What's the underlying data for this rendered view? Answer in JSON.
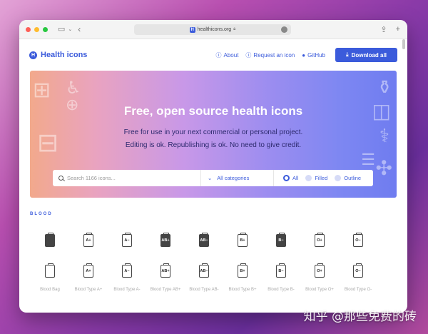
{
  "browser": {
    "url": "healthicons.org",
    "favicon_letter": "H"
  },
  "nav": {
    "logo_letter": "H",
    "brand": "Health icons",
    "links": [
      {
        "label": "About",
        "icon": "info-icon"
      },
      {
        "label": "Request an icon",
        "icon": "help-icon"
      },
      {
        "label": "GitHub",
        "icon": "github-icon"
      }
    ],
    "download_label": "Download all"
  },
  "hero": {
    "title": "Free, open source health icons",
    "subtitle_line1": "Free for use in your next commercial or personal project.",
    "subtitle_line2": "Editing is ok. Republishing is ok. No need to give credit."
  },
  "search": {
    "placeholder": "Search 1166 icons...",
    "category_value": "All categories",
    "style_options": [
      {
        "label": "All",
        "selected": true
      },
      {
        "label": "Filled",
        "selected": false
      },
      {
        "label": "Outline",
        "selected": false
      }
    ]
  },
  "section": {
    "title": "BLOOD"
  },
  "icons": {
    "filled_row": [
      "",
      "A+",
      "A−",
      "AB+",
      "AB−",
      "B+",
      "B−",
      "O+",
      "O−"
    ],
    "outline_row": [
      "",
      "A+",
      "A−",
      "AB+",
      "AB−",
      "B+",
      "B−",
      "O+",
      "O−"
    ],
    "labels": [
      "Blood Bag",
      "Blood Type A+",
      "Blood Type A-",
      "Blood Type AB+",
      "Blood Type AB-",
      "Blood Type B+",
      "Blood Type B-",
      "Blood Type O+",
      "Blood Type O-"
    ]
  },
  "watermark": "知乎 @那些免费的砖",
  "colors": {
    "accent": "#3b5bdb"
  }
}
